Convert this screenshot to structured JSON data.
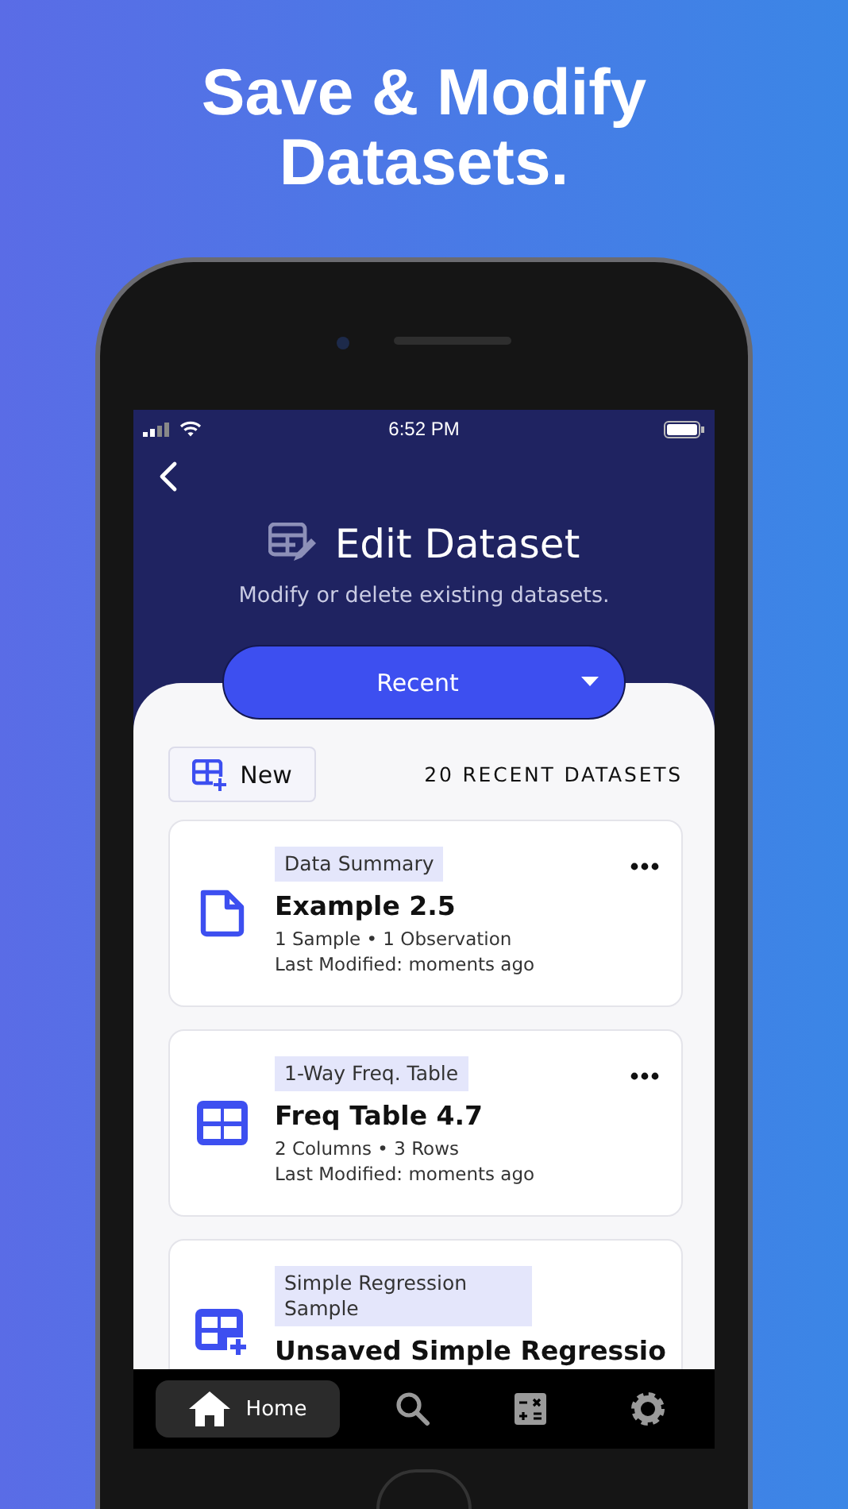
{
  "headline": "Save & Modify Datasets.",
  "status_bar": {
    "time": "6:52 PM"
  },
  "header": {
    "title": "Edit Dataset",
    "subtitle": "Modify or delete existing datasets."
  },
  "filter_dropdown": {
    "value": "Recent"
  },
  "toolbar": {
    "new_button": "New",
    "count_label": "20 RECENT DATASETS"
  },
  "datasets": [
    {
      "kind": "document",
      "tag": "Data Summary",
      "title": "Example 2.5",
      "details": "1 Sample • 1 Observation",
      "modified": "Last Modified: moments ago"
    },
    {
      "kind": "grid",
      "tag": "1-Way Freq. Table",
      "title": "Freq Table 4.7",
      "details": "2 Columns • 3 Rows",
      "modified": "Last Modified: moments ago"
    },
    {
      "kind": "regression",
      "tag": "Simple Regression Sample",
      "title": "Unsaved Simple Regressio"
    }
  ],
  "tab_bar": [
    {
      "kind": "home",
      "label": "Home",
      "selected": true
    },
    {
      "kind": "search",
      "selected": false
    },
    {
      "kind": "calculator",
      "selected": false
    },
    {
      "kind": "settings",
      "selected": false
    }
  ]
}
